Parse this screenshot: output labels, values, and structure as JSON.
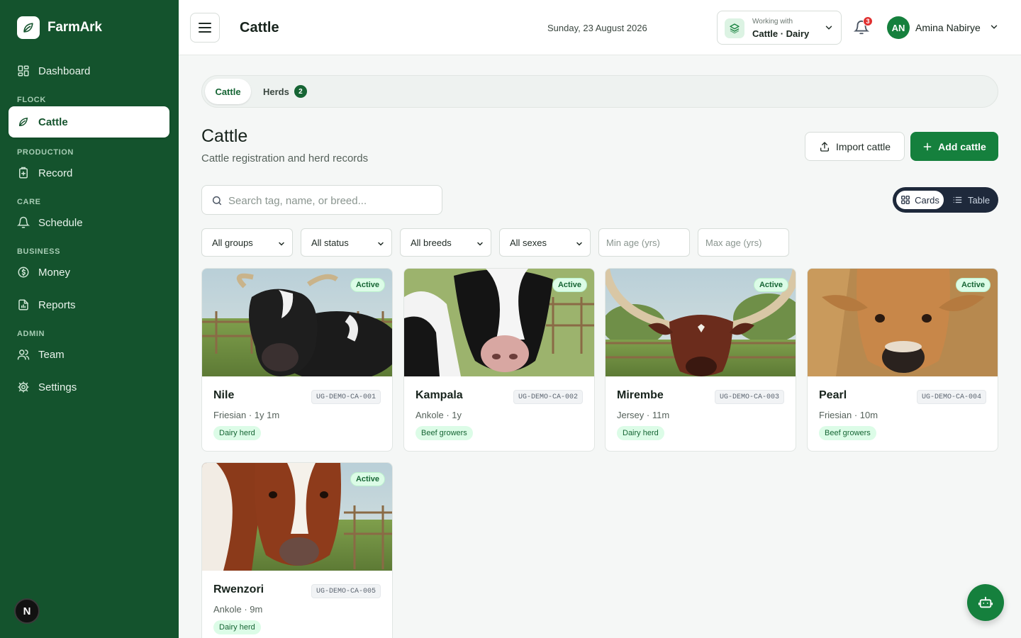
{
  "app": {
    "name": "FarmArk"
  },
  "sidebar": {
    "dashboard": "Dashboard",
    "sections": {
      "flock": "FLOCK",
      "production": "PRODUCTION",
      "care": "CARE",
      "business": "BUSINESS",
      "admin": "ADMIN"
    },
    "items": {
      "cattle": "Cattle",
      "record": "Record",
      "schedule": "Schedule",
      "money": "Money",
      "reports": "Reports",
      "team": "Team",
      "settings": "Settings"
    },
    "footer_badge": "N",
    "active_item": "Cattle",
    "accent": "#14532d"
  },
  "topbar": {
    "title": "Cattle",
    "date": "Sunday, 23 August 2026",
    "context": {
      "label": "Working with",
      "value": "Cattle · Dairy"
    },
    "notifications_count": "3",
    "user": {
      "initials": "AN",
      "name": "Amina Nabirye"
    }
  },
  "tabs": [
    {
      "label": "Cattle",
      "active": true
    },
    {
      "label": "Herds",
      "count": "2",
      "active": false
    }
  ],
  "page": {
    "title": "Cattle",
    "subtitle": "Cattle registration and herd records",
    "import_label": "Import cattle",
    "add_label": "Add cattle"
  },
  "search": {
    "placeholder": "Search tag, name, or breed...",
    "value": ""
  },
  "view_toggle": {
    "cards": "Cards",
    "table": "Table",
    "selected": "Cards"
  },
  "filters": {
    "groups": "All groups",
    "status": "All status",
    "breeds": "All breeds",
    "sexes": "All sexes",
    "min_age_placeholder": "Min age (yrs)",
    "max_age_placeholder": "Max age (yrs)"
  },
  "cattle": [
    {
      "name": "Nile",
      "tag": "UG-DEMO-CA-001",
      "meta": "Friesian · 1y 1m",
      "group": "Dairy herd",
      "status": "Active",
      "image": "black-and-white-cow-photo"
    },
    {
      "name": "Kampala",
      "tag": "UG-DEMO-CA-002",
      "meta": "Ankole · 1y",
      "group": "Beef growers",
      "status": "Active",
      "image": "black-and-white-cow-closeup-photo"
    },
    {
      "name": "Mirembe",
      "tag": "UG-DEMO-CA-003",
      "meta": "Jersey · 11m",
      "group": "Dairy herd",
      "status": "Active",
      "image": "brown-long-horned-cow-photo"
    },
    {
      "name": "Pearl",
      "tag": "UG-DEMO-CA-004",
      "meta": "Friesian · 10m",
      "group": "Beef growers",
      "status": "Active",
      "image": "tan-jersey-cow-photo"
    },
    {
      "name": "Rwenzori",
      "tag": "UG-DEMO-CA-005",
      "meta": "Ankole · 9m",
      "group": "Dairy herd",
      "status": "Active",
      "image": "brown-and-white-cow-photo"
    }
  ],
  "colors": {
    "primary": "#15803d",
    "sidebar": "#14532d",
    "badge": "#dcfce7",
    "alert": "#e03131"
  }
}
